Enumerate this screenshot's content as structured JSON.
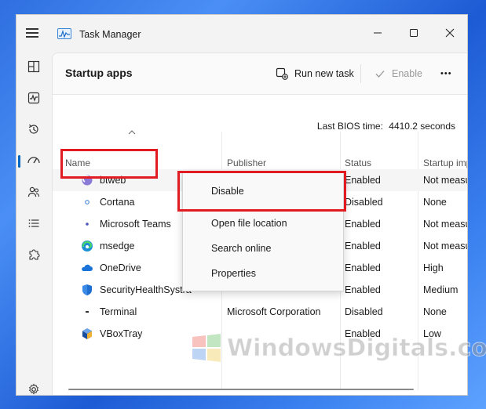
{
  "window": {
    "title": "Task Manager"
  },
  "header": {
    "page_title": "Startup apps",
    "run_new_task_label": "Run new task",
    "enable_label": "Enable",
    "more_label": "•••"
  },
  "bios": {
    "label": "Last BIOS time:",
    "value": "4410.2 seconds"
  },
  "columns": {
    "name": "Name",
    "publisher": "Publisher",
    "status": "Status",
    "impact": "Startup imp"
  },
  "rows": [
    {
      "name": "btweb",
      "publisher": "",
      "status": "Enabled",
      "impact": "Not measu",
      "icon": "btweb-icon"
    },
    {
      "name": "Cortana",
      "publisher": "",
      "status": "Disabled",
      "impact": "None",
      "icon": "cortana-icon"
    },
    {
      "name": "Microsoft Teams",
      "publisher": "",
      "status": "Enabled",
      "impact": "Not measu",
      "icon": "teams-icon"
    },
    {
      "name": "msedge",
      "publisher": "",
      "status": "Enabled",
      "impact": "Not measu",
      "icon": "edge-icon"
    },
    {
      "name": "OneDrive",
      "publisher": "",
      "status": "Enabled",
      "impact": "High",
      "icon": "onedrive-icon"
    },
    {
      "name": "SecurityHealthSystra",
      "publisher": "",
      "status": "Enabled",
      "impact": "Medium",
      "icon": "shield-icon"
    },
    {
      "name": "Terminal",
      "publisher": "Microsoft Corporation",
      "status": "Disabled",
      "impact": "None",
      "icon": "terminal-icon"
    },
    {
      "name": "VBoxTray",
      "publisher": "",
      "status": "Enabled",
      "impact": "Low",
      "icon": "vbox-icon"
    }
  ],
  "context_menu": {
    "items": [
      "Disable",
      "Open file location",
      "Search online",
      "Properties"
    ]
  },
  "watermark": {
    "text": "WindowsDigitals.com"
  },
  "colors": {
    "accent": "#0067c0",
    "highlight_box": "#e21b23"
  }
}
